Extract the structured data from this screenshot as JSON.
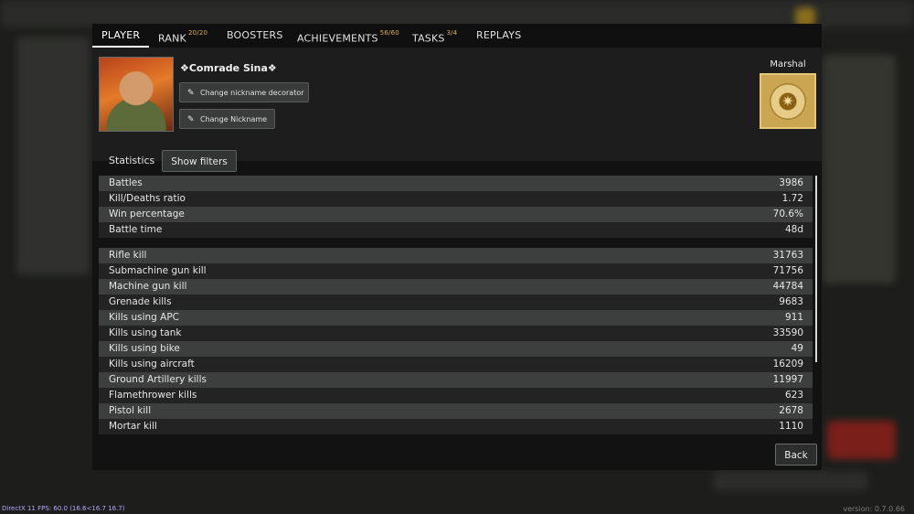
{
  "tabs": [
    {
      "label": "PLAYER",
      "badge": ""
    },
    {
      "label": "RANK",
      "badge": "20/20"
    },
    {
      "label": "BOOSTERS",
      "badge": ""
    },
    {
      "label": "ACHIEVEMENTS",
      "badge": "56/60"
    },
    {
      "label": "TASKS",
      "badge": "3/4"
    },
    {
      "label": "REPLAYS",
      "badge": ""
    }
  ],
  "profile": {
    "nickname": "❖Comrade Sina❖",
    "change_decorator_label": "Change nickname decorator",
    "change_nickname_label": "Change Nickname",
    "rank_name": "Marshal"
  },
  "statistics": {
    "label": "Statistics",
    "show_filters_label": "Show filters",
    "general": [
      {
        "name": "Battles",
        "value": "3986"
      },
      {
        "name": "Kill/Deaths ratio",
        "value": "1.72"
      },
      {
        "name": "Win percentage",
        "value": "70.6%"
      },
      {
        "name": "Battle time",
        "value": "48d"
      }
    ],
    "kills": [
      {
        "name": "Rifle kill",
        "value": "31763"
      },
      {
        "name": "Submachine gun kill",
        "value": "71756"
      },
      {
        "name": "Machine gun kill",
        "value": "44784"
      },
      {
        "name": "Grenade kills",
        "value": "9683"
      },
      {
        "name": "Kills using APC",
        "value": "911"
      },
      {
        "name": "Kills using tank",
        "value": "33590"
      },
      {
        "name": "Kills using bike",
        "value": "49"
      },
      {
        "name": "Kills using aircraft",
        "value": "16209"
      },
      {
        "name": "Ground Artillery kills",
        "value": "11997"
      },
      {
        "name": "Flamethrower kills",
        "value": "623"
      },
      {
        "name": "Pistol kill",
        "value": "2678"
      },
      {
        "name": "Mortar kill",
        "value": "1110"
      }
    ]
  },
  "back_label": "Back",
  "footer": {
    "fps": "DirectX 11 FPS: 60.0 (16.6<16.7 16.7)",
    "version": "version: 0.7.0.66"
  },
  "icons": {
    "edit": "pencil-icon",
    "rank_badge": "marshal-rank-icon"
  },
  "colors": {
    "badge_accent": "#e0b25a",
    "rank_gold": "#caa652"
  }
}
